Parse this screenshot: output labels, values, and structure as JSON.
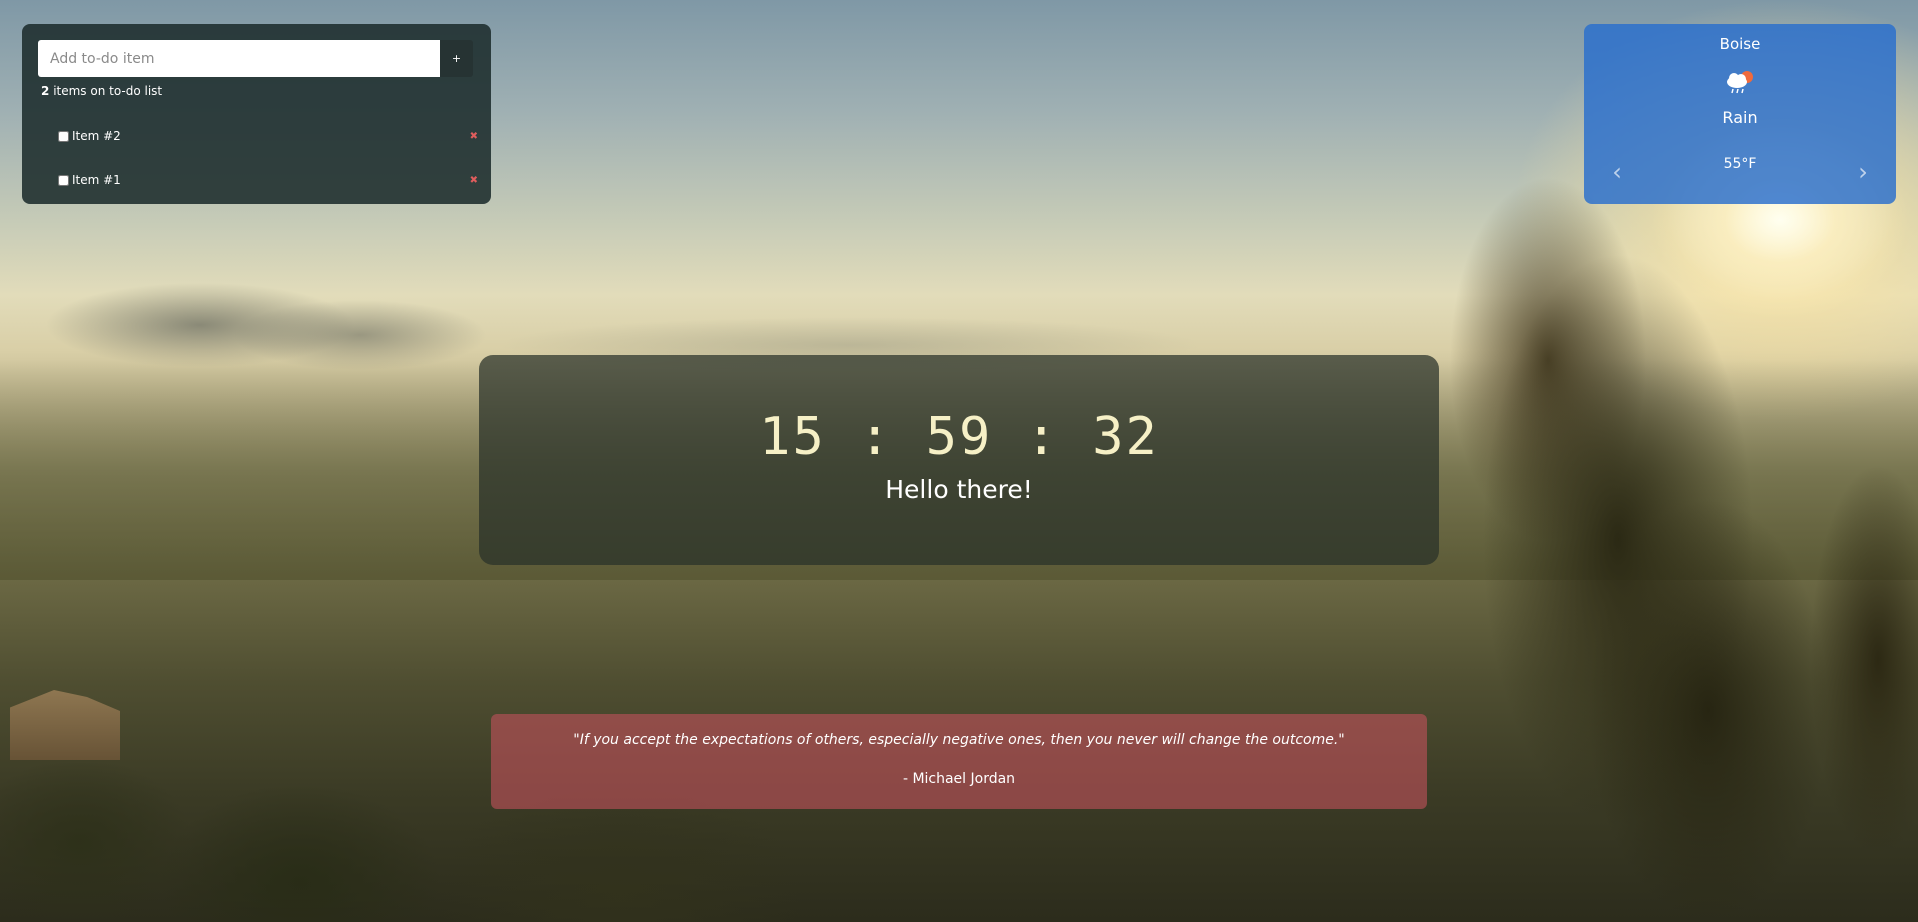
{
  "todo": {
    "input_placeholder": "Add to-do item",
    "add_label": "+",
    "count": "2",
    "count_label": "items on to-do list",
    "items": [
      {
        "label": "Item #2",
        "delete_icon": "✖"
      },
      {
        "label": "Item #1",
        "delete_icon": "✖"
      }
    ]
  },
  "weather": {
    "city": "Boise",
    "condition": "Rain",
    "temperature": "55°F",
    "icon": "cloud-sun-rain-icon",
    "prev_arrow": "‹",
    "next_arrow": "›",
    "panel_color": "#2f6fcc"
  },
  "clock": {
    "time": "15 : 59 : 32",
    "greeting": "Hello there!",
    "time_color": "#f6f0c6"
  },
  "quote": {
    "text": "\"If you accept the expectations of others, especially negative ones, then you never will change the outcome.\"",
    "author": "- Michael Jordan",
    "card_color": "#be505a"
  }
}
